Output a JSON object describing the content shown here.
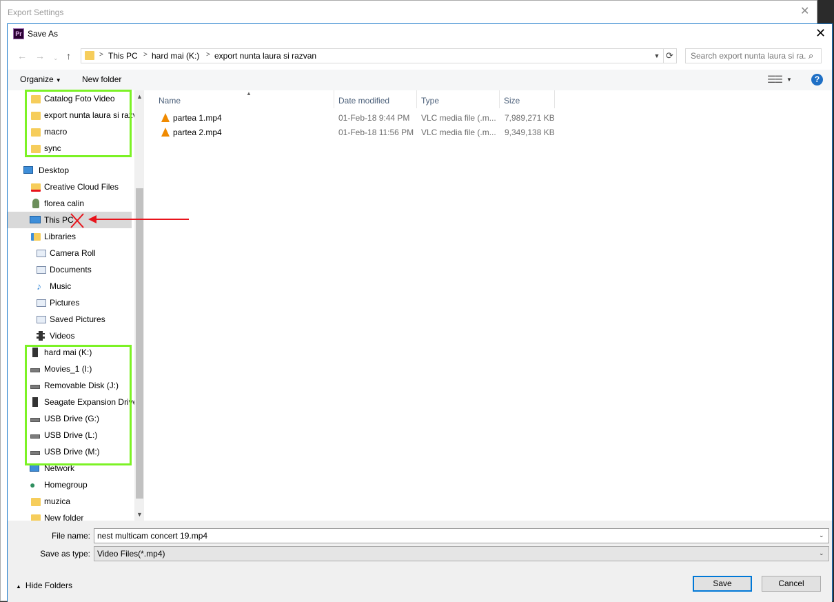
{
  "export_window": {
    "title": "Export Settings",
    "close": "✕"
  },
  "dialog": {
    "title": "Save As",
    "app_badge": "Pr",
    "close": "✕"
  },
  "address": {
    "crumbs": [
      "This PC",
      "hard mai (K:)",
      "export nunta laura si razvan"
    ],
    "search_placeholder": "Search export nunta laura si ra..."
  },
  "toolbar": {
    "organize_label": "Organize",
    "new_folder_label": "New folder",
    "help": "?"
  },
  "nav": {
    "items": [
      {
        "label": "Catalog Foto Video",
        "icon": "folder-icon"
      },
      {
        "label": "export nunta laura si razv",
        "icon": "folder-icon"
      },
      {
        "label": "macro",
        "icon": "folder-icon"
      },
      {
        "label": "sync",
        "icon": "folder-icon"
      },
      {
        "label": "Desktop",
        "icon": "desktop-icon"
      },
      {
        "label": "Creative Cloud Files",
        "icon": "creative-cloud-folder-icon"
      },
      {
        "label": "florea calin",
        "icon": "user-icon"
      },
      {
        "label": "This PC",
        "icon": "computer-icon"
      },
      {
        "label": "Libraries",
        "icon": "libraries-icon"
      },
      {
        "label": "Camera Roll",
        "icon": "library-icon"
      },
      {
        "label": "Documents",
        "icon": "library-icon"
      },
      {
        "label": "Music",
        "icon": "music-icon"
      },
      {
        "label": "Pictures",
        "icon": "library-icon"
      },
      {
        "label": "Saved Pictures",
        "icon": "library-icon"
      },
      {
        "label": "Videos",
        "icon": "videos-icon"
      },
      {
        "label": "hard mai (K:)",
        "icon": "external-drive-icon"
      },
      {
        "label": "Movies_1 (I:)",
        "icon": "drive-icon"
      },
      {
        "label": "Removable Disk (J:)",
        "icon": "drive-icon"
      },
      {
        "label": "Seagate Expansion Drive",
        "icon": "external-drive-icon"
      },
      {
        "label": "USB Drive (G:)",
        "icon": "drive-icon"
      },
      {
        "label": "USB Drive (L:)",
        "icon": "drive-icon"
      },
      {
        "label": "USB Drive (M:)",
        "icon": "drive-icon"
      },
      {
        "label": "Network",
        "icon": "network-icon"
      },
      {
        "label": "Homegroup",
        "icon": "homegroup-icon"
      },
      {
        "label": "muzica",
        "icon": "folder-icon"
      },
      {
        "label": "New folder",
        "icon": "folder-icon"
      }
    ],
    "selected": "This PC"
  },
  "files": {
    "columns": [
      "Name",
      "Date modified",
      "Type",
      "Size"
    ],
    "rows": [
      {
        "name": "partea 1.mp4",
        "date": "01-Feb-18 9:44 PM",
        "type": "VLC media file (.m...",
        "size": "7,989,271 KB"
      },
      {
        "name": "partea 2.mp4",
        "date": "01-Feb-18 11:56 PM",
        "type": "VLC media file (.m...",
        "size": "9,349,138 KB"
      }
    ]
  },
  "bottom": {
    "file_name_label": "File name:",
    "file_name_value": "nest multicam concert 19.mp4",
    "save_as_type_label": "Save as type:",
    "save_as_type_value": "Video Files(*.mp4)",
    "hide_folders_label": "Hide Folders",
    "save_label": "Save",
    "cancel_label": "Cancel"
  },
  "colors": {
    "annotation_box": "#7cf225",
    "annotation_arrow": "#e8141c",
    "accent": "#0078d7"
  }
}
